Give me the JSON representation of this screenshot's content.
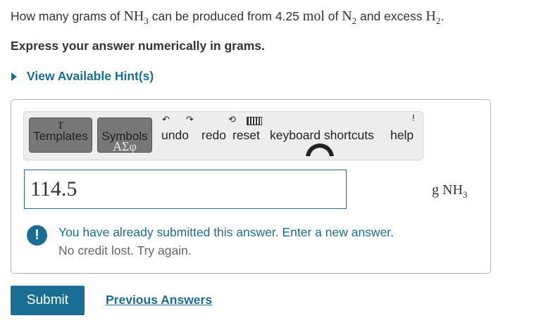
{
  "question": {
    "part1": "How many grams of ",
    "nh3_base": "NH",
    "nh3_sub": "3",
    "part2": " can be produced from ",
    "amount": "4.25",
    "mol": "mol",
    "part3": " of ",
    "n2_base": "N",
    "n2_sub": "2",
    "part4": " and excess ",
    "h2_base": "H",
    "h2_sub": "2",
    "end": "."
  },
  "instruction": "Express your answer numerically in grams.",
  "hint_label": "View Available Hint(s)",
  "toolbar": {
    "templates_label": "Templates",
    "templates_glyph": "τ",
    "symbols_label": "Symbols",
    "symbols_glyph": "ΑΣφ",
    "undo_label": "undo",
    "redo_label": "redo",
    "reset_label": "reset",
    "keyboard_label": "keyboard shortcuts",
    "help_label": "help"
  },
  "answer": {
    "value": "114.5",
    "unit_base": "g NH",
    "unit_sub": "3"
  },
  "feedback": {
    "icon": "!",
    "main": "You have already submitted this answer. Enter a new answer.",
    "sub": "No credit lost. Try again."
  },
  "actions": {
    "submit_label": "Submit",
    "previous_answers_label": "Previous Answers"
  },
  "colors": {
    "accent": "#1a6e94",
    "text": "#333333",
    "muted": "#666666"
  }
}
